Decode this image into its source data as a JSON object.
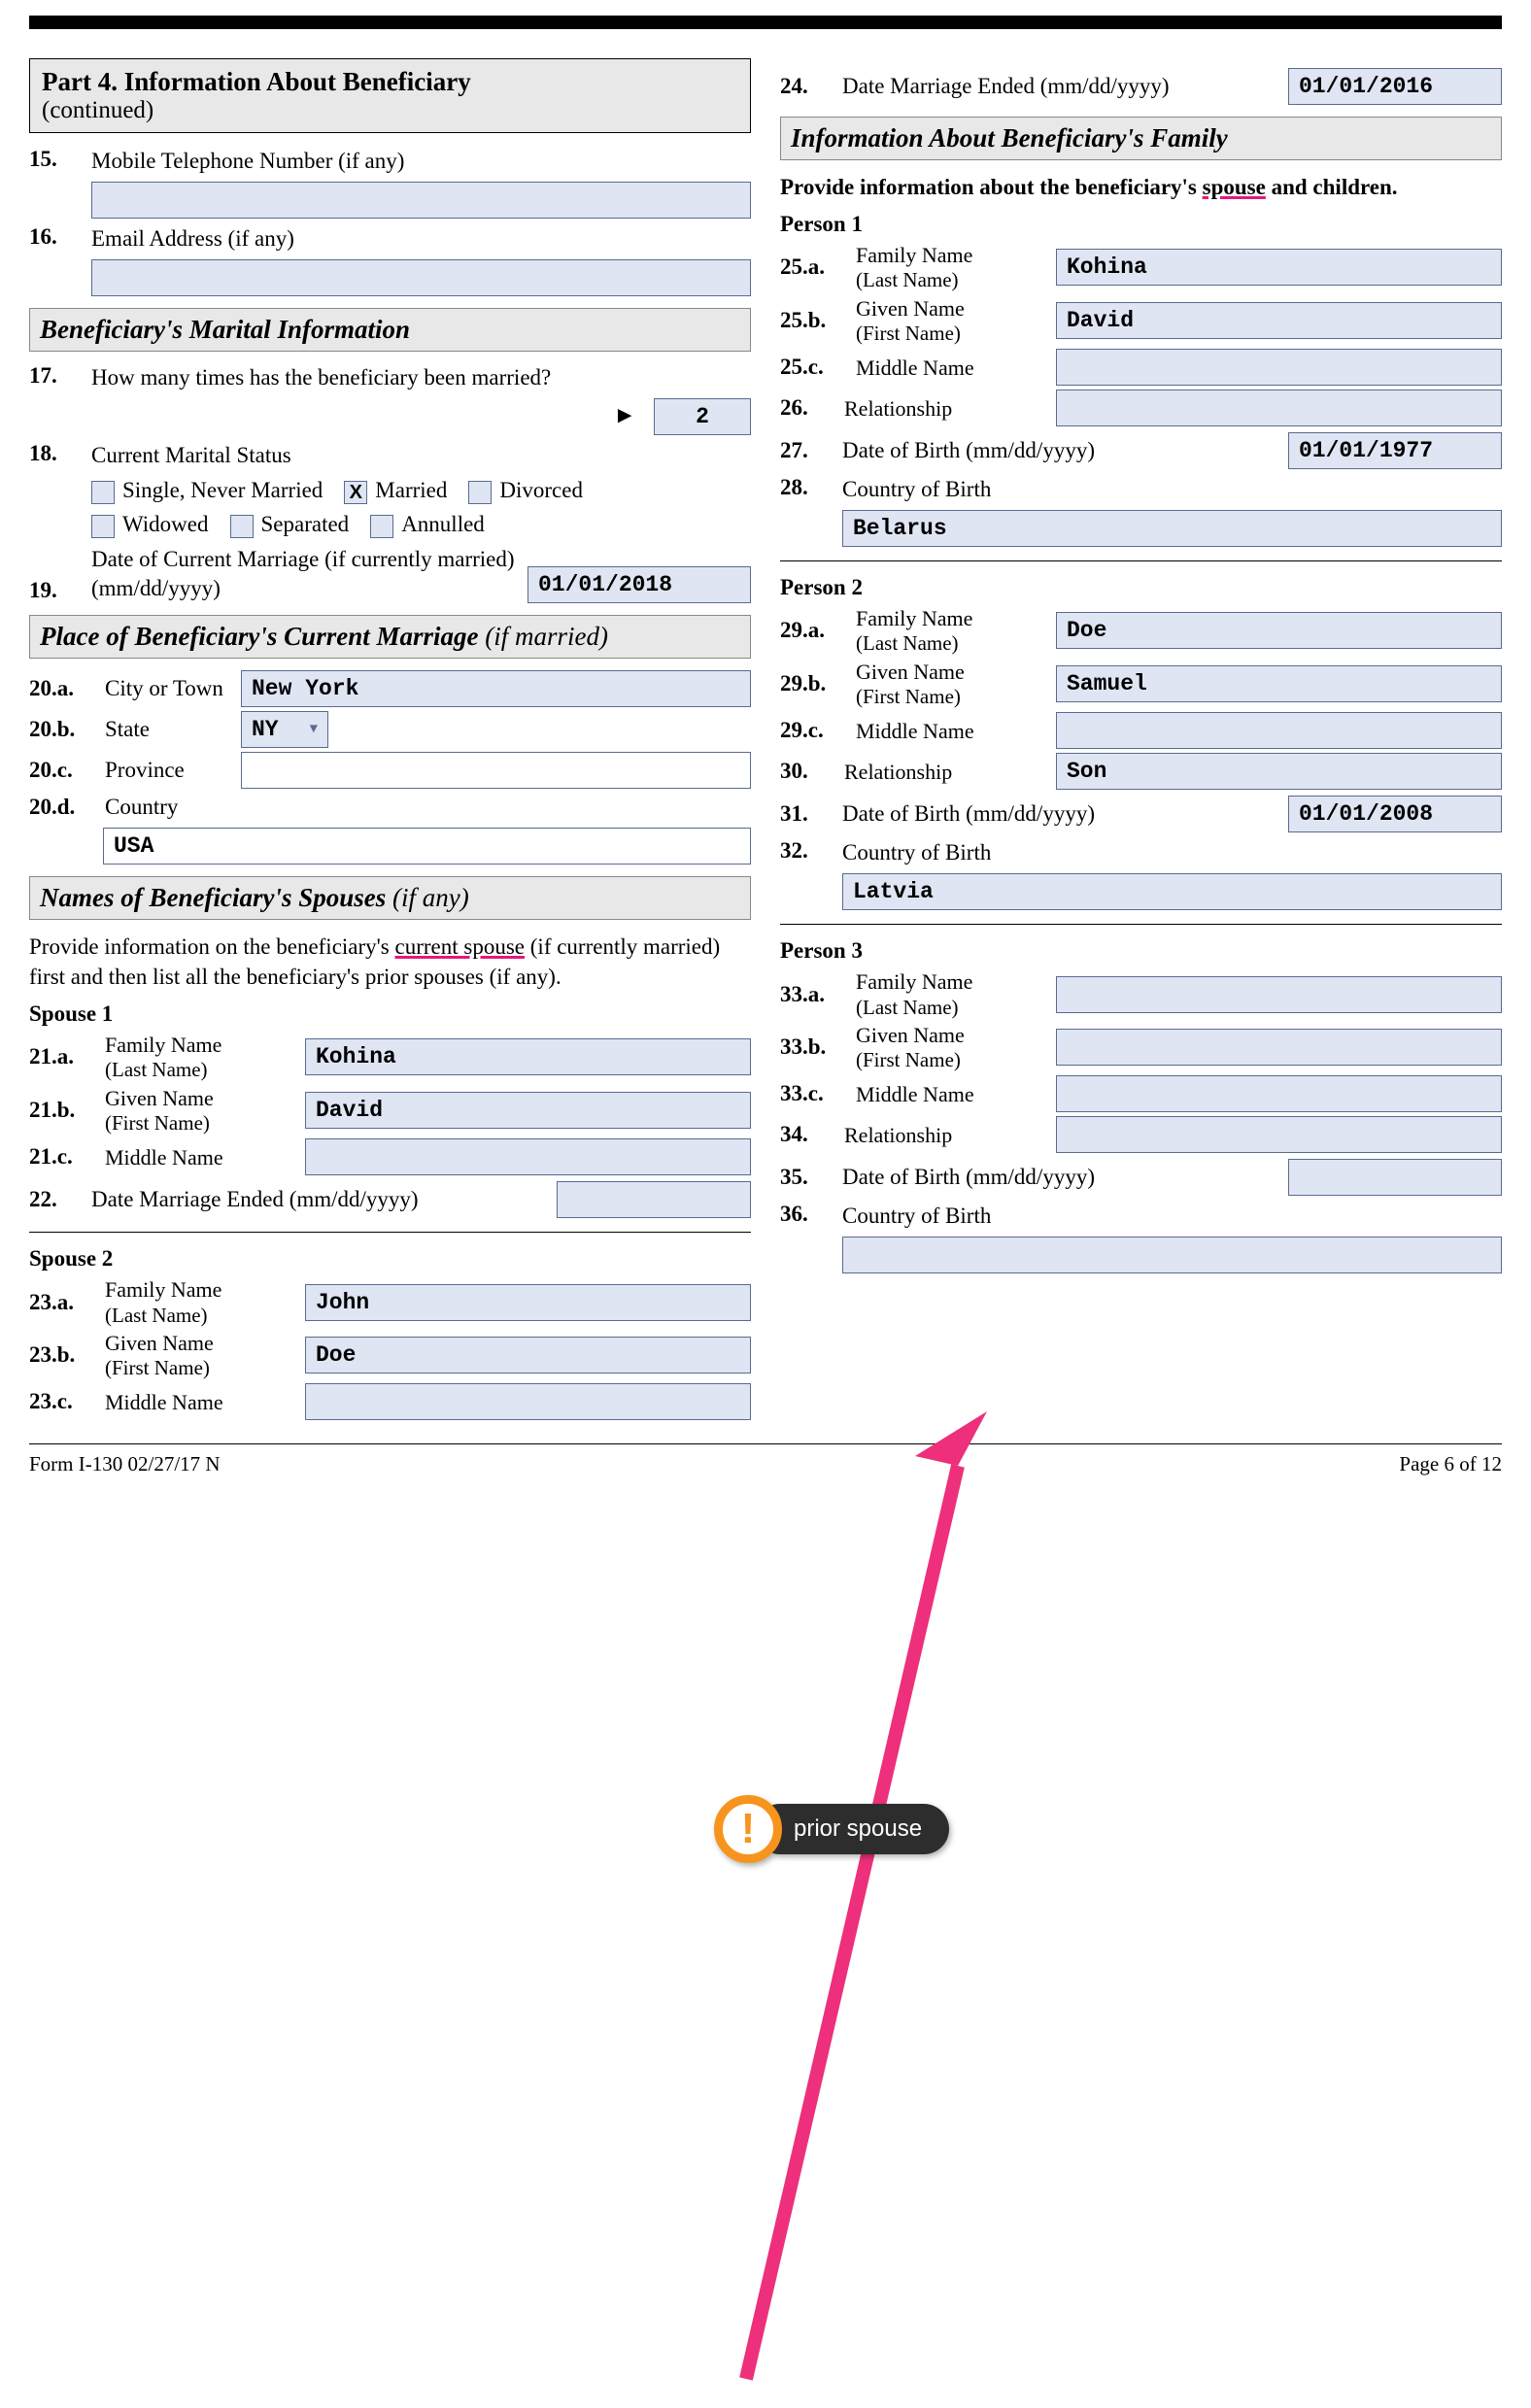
{
  "part4": {
    "header_bold": "Part 4.  Information About Beneficiary",
    "header_cont": "(continued)"
  },
  "q15": {
    "num": "15.",
    "label": "Mobile Telephone Number (if any)",
    "value": ""
  },
  "q16": {
    "num": "16.",
    "label": "Email Address (if any)",
    "value": ""
  },
  "marital_header": "Beneficiary's Marital Information",
  "q17": {
    "num": "17.",
    "label": "How many times has the beneficiary been married?",
    "value": "2"
  },
  "q18": {
    "num": "18.",
    "label": "Current Marital Status",
    "opts": {
      "single": "Single, Never Married",
      "married": "Married",
      "divorced": "Divorced",
      "widowed": "Widowed",
      "separated": "Separated",
      "annulled": "Annulled"
    },
    "checked": "married"
  },
  "q19": {
    "num": "19.",
    "label": "Date of  Current Marriage (if currently married) (mm/dd/yyyy)",
    "value": "01/01/2018"
  },
  "place_header": "Place of Beneficiary's Current Marriage",
  "place_header_sub": "(if married)",
  "q20a": {
    "num": "20.a.",
    "label": "City or Town",
    "value": "New York"
  },
  "q20b": {
    "num": "20.b.",
    "label": "State",
    "value": "NY"
  },
  "q20c": {
    "num": "20.c.",
    "label": "Province",
    "value": ""
  },
  "q20d": {
    "num": "20.d.",
    "label": "Country",
    "value": "USA"
  },
  "spouses_header": "Names of Beneficiary's Spouses",
  "spouses_header_sub": "(if any)",
  "spouses_intro_a": "Provide information on the beneficiary's ",
  "spouses_intro_b": "current spouse",
  "spouses_intro_c": " (if currently married) first and then list all the beneficiary's prior spouses (if any).",
  "spouse1_title": "Spouse 1",
  "q21a": {
    "num": "21.a.",
    "label": "Family Name",
    "sublabel": "(Last Name)",
    "value": "Kohina"
  },
  "q21b": {
    "num": "21.b.",
    "label": "Given Name",
    "sublabel": "(First Name)",
    "value": "David"
  },
  "q21c": {
    "num": "21.c.",
    "label": "Middle Name",
    "value": ""
  },
  "q22": {
    "num": "22.",
    "label": "Date Marriage Ended (mm/dd/yyyy)",
    "value": ""
  },
  "spouse2_title": "Spouse 2",
  "q23a": {
    "num": "23.a.",
    "label": "Family Name",
    "sublabel": "(Last Name)",
    "value": "John"
  },
  "q23b": {
    "num": "23.b.",
    "label": "Given Name",
    "sublabel": "(First Name)",
    "value": "Doe"
  },
  "q23c": {
    "num": "23.c.",
    "label": "Middle Name",
    "value": ""
  },
  "q24": {
    "num": "24.",
    "label": "Date Marriage Ended (mm/dd/yyyy)",
    "value": "01/01/2016"
  },
  "family_header": "Information About Beneficiary's Family",
  "family_intro_a": "Provide information about the beneficiary's ",
  "family_intro_b": "spouse",
  "family_intro_c": " and children.",
  "person1_title": "Person 1",
  "q25a": {
    "num": "25.a.",
    "label": "Family Name",
    "sublabel": "(Last Name)",
    "value": "Kohina"
  },
  "q25b": {
    "num": "25.b.",
    "label": "Given Name",
    "sublabel": "(First Name)",
    "value": "David"
  },
  "q25c": {
    "num": "25.c.",
    "label": "Middle Name",
    "value": ""
  },
  "q26": {
    "num": "26.",
    "label": "Relationship",
    "value": ""
  },
  "q27": {
    "num": "27.",
    "label": "Date of Birth (mm/dd/yyyy)",
    "value": "01/01/1977"
  },
  "q28": {
    "num": "28.",
    "label": "Country of Birth",
    "value": "Belarus"
  },
  "person2_title": "Person 2",
  "q29a": {
    "num": "29.a.",
    "label": "Family Name",
    "sublabel": "(Last Name)",
    "value": "Doe"
  },
  "q29b": {
    "num": "29.b.",
    "label": "Given Name",
    "sublabel": "(First Name)",
    "value": "Samuel"
  },
  "q29c": {
    "num": "29.c.",
    "label": "Middle Name",
    "value": ""
  },
  "q30": {
    "num": "30.",
    "label": "Relationship",
    "value": "Son"
  },
  "q31": {
    "num": "31.",
    "label": "Date of Birth (mm/dd/yyyy)",
    "value": "01/01/2008"
  },
  "q32": {
    "num": "32.",
    "label": "Country of Birth",
    "value": "Latvia"
  },
  "person3_title": "Person 3",
  "q33a": {
    "num": "33.a.",
    "label": "Family Name",
    "sublabel": "(Last Name)",
    "value": ""
  },
  "q33b": {
    "num": "33.b.",
    "label": "Given Name",
    "sublabel": "(First Name)",
    "value": ""
  },
  "q33c": {
    "num": "33.c.",
    "label": "Middle Name",
    "value": ""
  },
  "q34": {
    "num": "34.",
    "label": "Relationship",
    "value": ""
  },
  "q35": {
    "num": "35.",
    "label": "Date of Birth (mm/dd/yyyy)",
    "value": ""
  },
  "q36": {
    "num": "36.",
    "label": "Country of Birth",
    "value": ""
  },
  "footer_left": "Form I-130   02/27/17   N",
  "footer_right": "Page 6 of 12",
  "bubble_text": "prior spouse"
}
